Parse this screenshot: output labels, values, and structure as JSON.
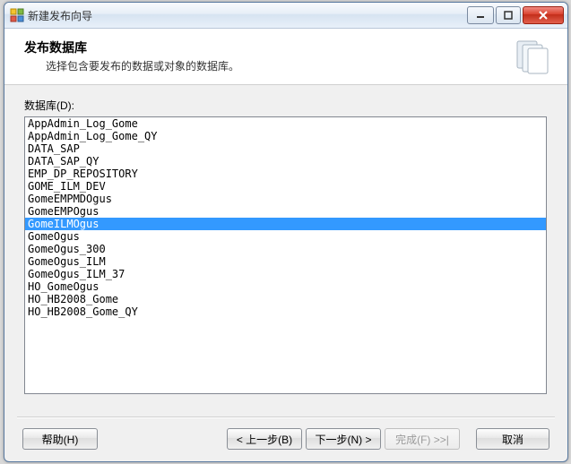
{
  "window": {
    "title": "新建发布向导"
  },
  "header": {
    "title": "发布数据库",
    "subtitle": "选择包含要发布的数据或对象的数据库。"
  },
  "body": {
    "label": "数据库(D):"
  },
  "databases": {
    "items": [
      "AppAdmin_Log_Gome",
      "AppAdmin_Log_Gome_QY",
      "DATA_SAP",
      "DATA_SAP_QY",
      "EMP_DP_REPOSITORY",
      "GOME_ILM_DEV",
      "GomeEMPMDOgus",
      "GomeEMPOgus",
      "GomeILMOgus",
      "GomeOgus",
      "GomeOgus_300",
      "GomeOgus_ILM",
      "GomeOgus_ILM_37",
      "HO_GomeOgus",
      "HO_HB2008_Gome",
      "HO_HB2008_Gome_QY"
    ],
    "selectedIndex": 8
  },
  "footer": {
    "help": "帮助(H)",
    "back": "< 上一步(B)",
    "next": "下一步(N) >",
    "finish": "完成(F) >>|",
    "cancel": "取消"
  },
  "icons": {
    "app": "wizard-icon",
    "header": "database-stack-icon"
  },
  "colors": {
    "selection": "#3399ff",
    "windowBg": "#f0f0f0",
    "border": "#828790"
  }
}
